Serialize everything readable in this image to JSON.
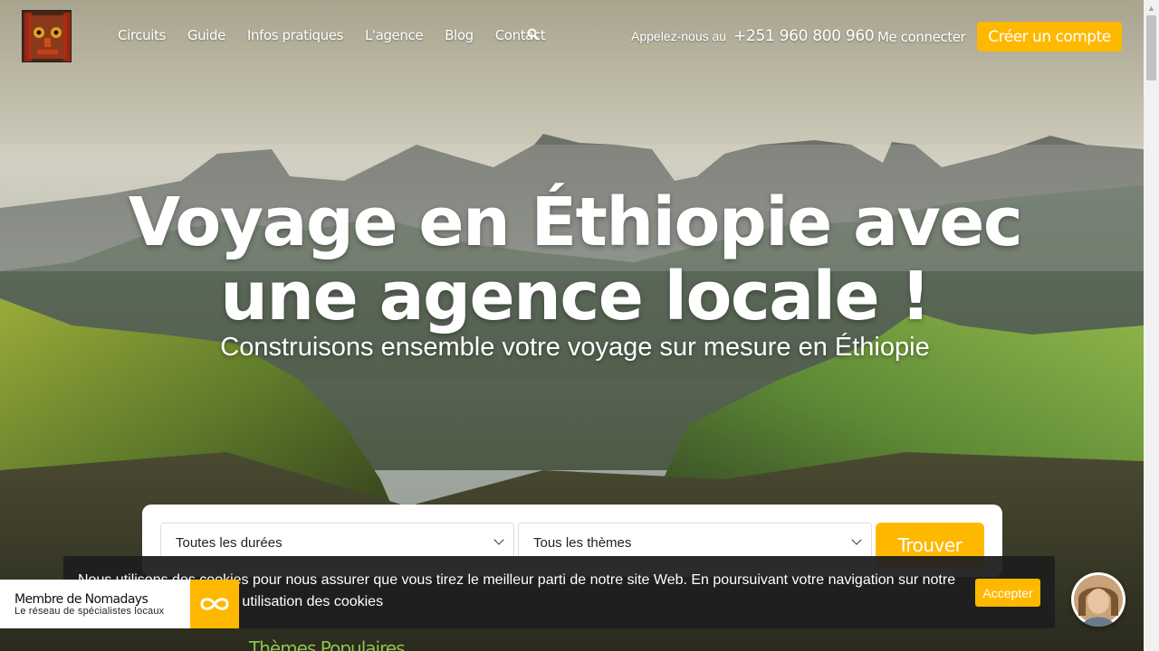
{
  "header": {
    "nav": [
      "Circuits",
      "Guide",
      "Infos pratiques",
      "L'agence",
      "Blog",
      "Contact"
    ],
    "call_label": "Appelez-nous au",
    "phone": "+251 960 800 960",
    "login": "Me connecter",
    "signup": "Créer un compte",
    "search_icon": "search-icon"
  },
  "hero": {
    "title": "Voyage en Éthiopie avec une agence locale !",
    "subtitle": "Construisons ensemble votre voyage sur mesure en Éthiopie"
  },
  "search": {
    "duration_selected": "Toutes les durées",
    "theme_selected": "Tous les thèmes",
    "find_label": "Trouver"
  },
  "teaser": "Thèmes Populaires",
  "cookie": {
    "text": "Nous utilisons des cookies pour nous assurer que vous tirez le meilleur parti de notre site Web. En poursuivant votre navigation sur notre site, vous acceptez notre utilisation des cookies",
    "accept": "Accepter"
  },
  "badge": {
    "title": "Membre de Nomadays",
    "subtitle": "Le réseau de spécialistes locaux"
  },
  "colors": {
    "accent": "#ffb800",
    "teaser_green": "#8bc34a"
  }
}
